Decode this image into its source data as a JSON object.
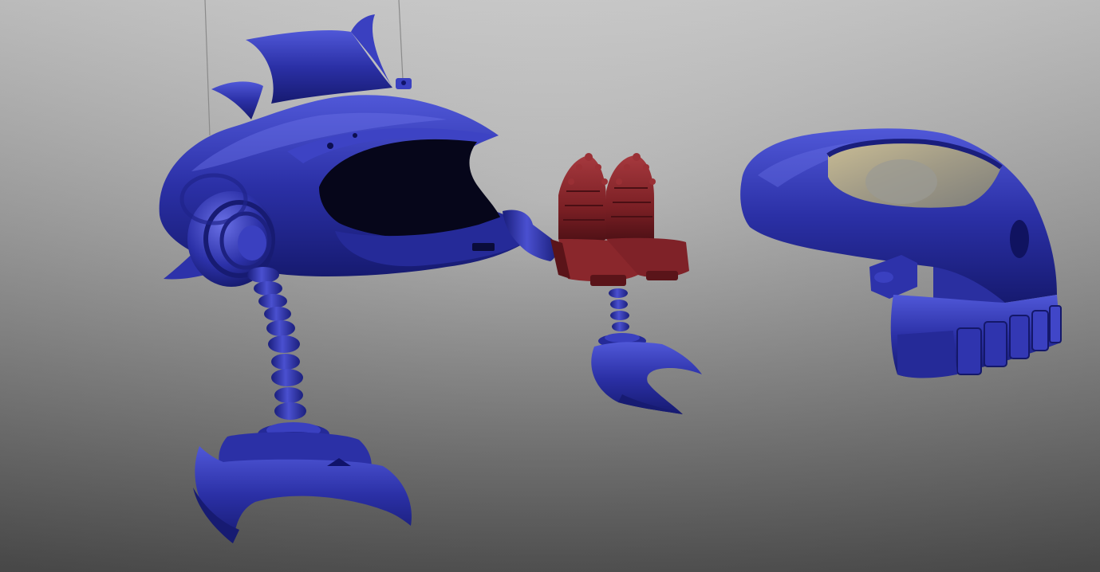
{
  "scene": {
    "background_top": "#cfcfcf",
    "background_bottom": "#555555",
    "colors": {
      "body_blue": "#2a2fa0",
      "body_blue_light": "#4f55d6",
      "body_blue_dark": "#14186a",
      "seat_red": "#7a1f24",
      "seat_red_light": "#a3383c",
      "seat_red_dark": "#4a0f14",
      "mouth_black": "#050510",
      "visor_tan": "#b8ab8a",
      "visor_grey": "#8e8e86",
      "wire": "#8a8a8a"
    },
    "objects": [
      "shark-body",
      "shark-leg-claw",
      "seat-pair",
      "seat-stem-claw",
      "skull-helmet"
    ]
  }
}
